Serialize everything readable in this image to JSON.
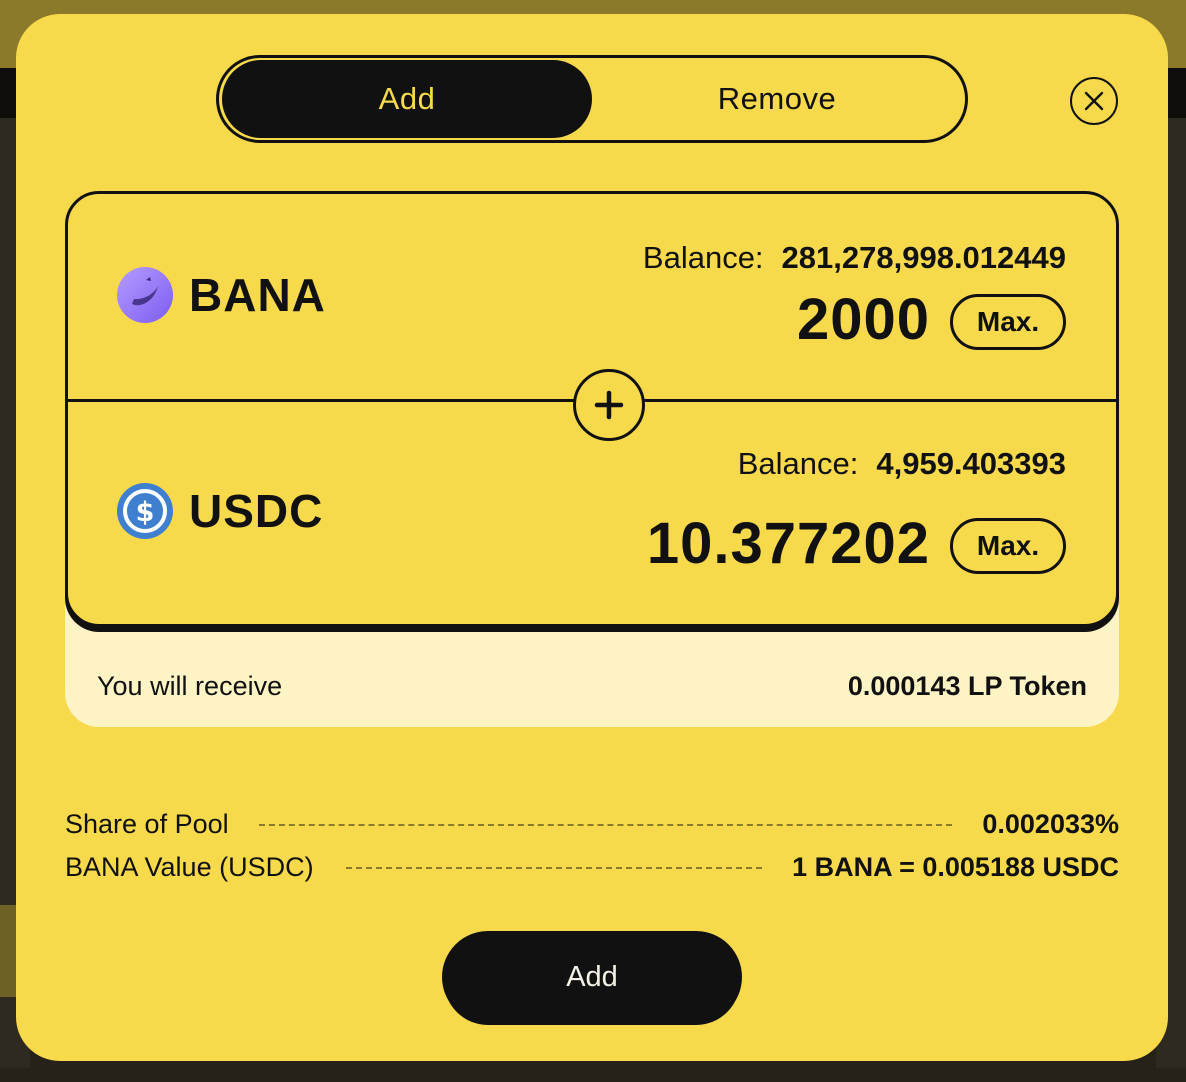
{
  "tabs": {
    "add_label": "Add",
    "remove_label": "Remove",
    "active": "Add"
  },
  "close": {
    "icon": "close-icon"
  },
  "token_a": {
    "symbol": "BANA",
    "icon": "bana-token-icon",
    "balance_label": "Balance:",
    "balance_value": "281,278,998.012449",
    "amount": "2000",
    "max_label": "Max."
  },
  "token_b": {
    "symbol": "USDC",
    "icon": "usdc-token-icon",
    "balance_label": "Balance:",
    "balance_value": "4,959.403393",
    "amount": "10.377202",
    "max_label": "Max."
  },
  "receive": {
    "label": "You will receive",
    "value": "0.000143 LP Token"
  },
  "info": {
    "share_label": "Share of Pool",
    "share_value": "0.002033%",
    "price_label": "BANA Value (USDC)",
    "price_value": "1 BANA = 0.005188 USDC"
  },
  "submit": {
    "label": "Add"
  },
  "colors": {
    "accent": "#f7d94c",
    "dark": "#111111",
    "receive_bg": "#fdf3c4"
  }
}
